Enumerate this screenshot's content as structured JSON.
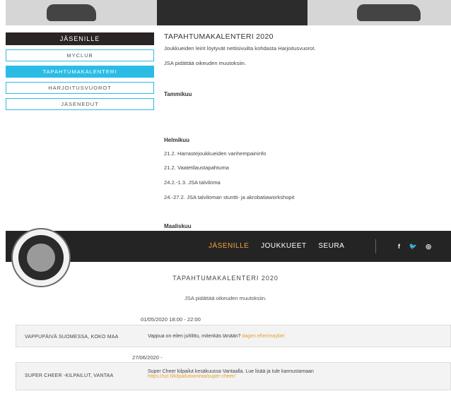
{
  "menu": {
    "header": "JÄSENILLE",
    "items": [
      {
        "label": "MYCLUB",
        "active": false
      },
      {
        "label": "TAPAHTUMAKALENTERI",
        "active": true
      },
      {
        "label": "HARJOITUSVUOROT",
        "active": false
      },
      {
        "label": "JÄSENEDUT",
        "active": false
      }
    ]
  },
  "content": {
    "title": "TAPAHTUMAKALENTERI 2020",
    "intro1": "Joukkueiden leirit löytyvät nettisivuilta kohdasta Harjoitusvuorot.",
    "intro2": "JSA pidättää oikeuden muutoksiin.",
    "months": {
      "jan": "Tammikuu",
      "feb": "Helmikuu",
      "mar": "Maaliskuu"
    },
    "feb_events": [
      "21.2.  Harrastejoukkueiden vanhempaininfo",
      "21.2. Vaatetilaustapahtuma",
      "24.2.-1.3. JSA talviloma",
      "24.-27.2. JSA talviloman stuntti- ja akrobatiaworkshopit"
    ]
  },
  "nav": {
    "links": [
      "JÄSENILLE",
      "JOUKKUEET",
      "SEURA"
    ],
    "social": [
      "f",
      "🐦",
      "◎"
    ]
  },
  "section": {
    "title": "TAPAHTUMAKALENTERI 2020",
    "note": "JSA pidättää oikeuden muutoksiin."
  },
  "events": [
    {
      "date": "01/05/2020 18:00 - 22:00",
      "name": "VAPPUPÄIVÄ SUOMESSA, KOKO MAA",
      "desc": "Vappua on eilen juhlittu, mitenkäs tänään?",
      "link": "dagen.efter/maybe/"
    },
    {
      "date": "27/06/2020 -",
      "name": "SUPER CHEER -KILPAILUT, VANTAA",
      "desc": "Super Cheer kilpailut kesäkuussa Vantaalla. Lue lisää ja tule kannustamaan",
      "link": "https://scl.fi/kilpailutoiminta/super-cheer/"
    }
  ],
  "colors": {
    "accent": "#2bbce6",
    "nav_active": "#f2a33a",
    "dark": "#242424"
  }
}
